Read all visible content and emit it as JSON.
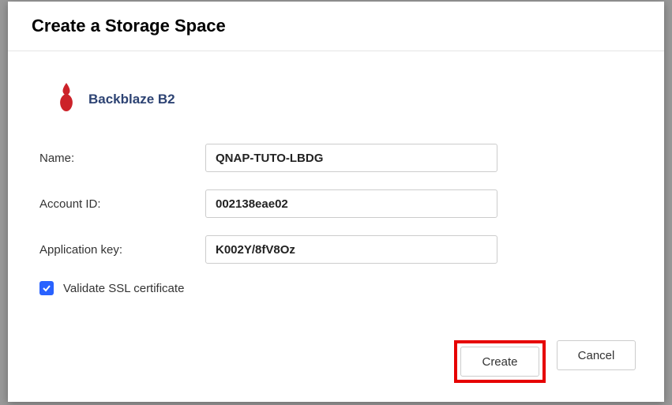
{
  "modal": {
    "title": "Create a Storage Space",
    "provider": {
      "name": "Backblaze B2"
    },
    "form": {
      "name_label": "Name:",
      "name_value": "QNAP-TUTO-LBDG",
      "account_label": "Account ID:",
      "account_value": "002138eae02",
      "appkey_label": "Application key:",
      "appkey_value": "K002Y/8fV8Oz",
      "ssl_label": "Validate SSL certificate"
    },
    "buttons": {
      "create": "Create",
      "cancel": "Cancel"
    }
  }
}
